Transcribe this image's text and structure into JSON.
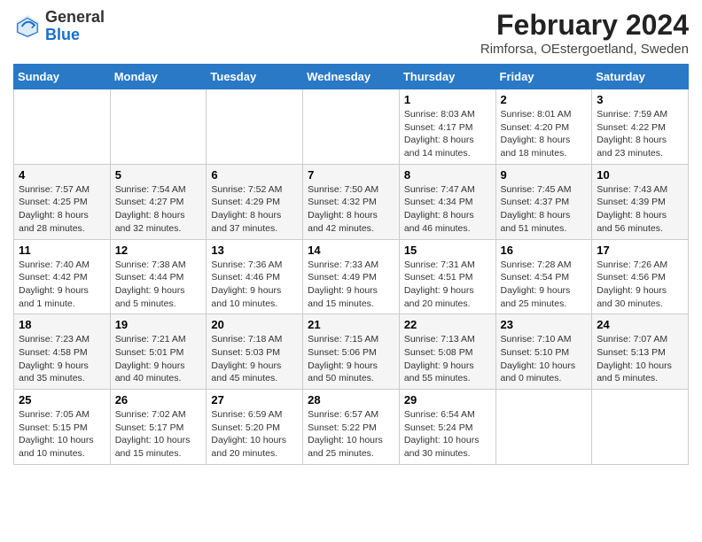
{
  "header": {
    "logo_general": "General",
    "logo_blue": "Blue",
    "title": "February 2024",
    "subtitle": "Rimforsa, OEstergoetland, Sweden"
  },
  "weekdays": [
    "Sunday",
    "Monday",
    "Tuesday",
    "Wednesday",
    "Thursday",
    "Friday",
    "Saturday"
  ],
  "weeks": [
    [
      {
        "day": "",
        "info": ""
      },
      {
        "day": "",
        "info": ""
      },
      {
        "day": "",
        "info": ""
      },
      {
        "day": "",
        "info": ""
      },
      {
        "day": "1",
        "info": "Sunrise: 8:03 AM\nSunset: 4:17 PM\nDaylight: 8 hours\nand 14 minutes."
      },
      {
        "day": "2",
        "info": "Sunrise: 8:01 AM\nSunset: 4:20 PM\nDaylight: 8 hours\nand 18 minutes."
      },
      {
        "day": "3",
        "info": "Sunrise: 7:59 AM\nSunset: 4:22 PM\nDaylight: 8 hours\nand 23 minutes."
      }
    ],
    [
      {
        "day": "4",
        "info": "Sunrise: 7:57 AM\nSunset: 4:25 PM\nDaylight: 8 hours\nand 28 minutes."
      },
      {
        "day": "5",
        "info": "Sunrise: 7:54 AM\nSunset: 4:27 PM\nDaylight: 8 hours\nand 32 minutes."
      },
      {
        "day": "6",
        "info": "Sunrise: 7:52 AM\nSunset: 4:29 PM\nDaylight: 8 hours\nand 37 minutes."
      },
      {
        "day": "7",
        "info": "Sunrise: 7:50 AM\nSunset: 4:32 PM\nDaylight: 8 hours\nand 42 minutes."
      },
      {
        "day": "8",
        "info": "Sunrise: 7:47 AM\nSunset: 4:34 PM\nDaylight: 8 hours\nand 46 minutes."
      },
      {
        "day": "9",
        "info": "Sunrise: 7:45 AM\nSunset: 4:37 PM\nDaylight: 8 hours\nand 51 minutes."
      },
      {
        "day": "10",
        "info": "Sunrise: 7:43 AM\nSunset: 4:39 PM\nDaylight: 8 hours\nand 56 minutes."
      }
    ],
    [
      {
        "day": "11",
        "info": "Sunrise: 7:40 AM\nSunset: 4:42 PM\nDaylight: 9 hours\nand 1 minute."
      },
      {
        "day": "12",
        "info": "Sunrise: 7:38 AM\nSunset: 4:44 PM\nDaylight: 9 hours\nand 5 minutes."
      },
      {
        "day": "13",
        "info": "Sunrise: 7:36 AM\nSunset: 4:46 PM\nDaylight: 9 hours\nand 10 minutes."
      },
      {
        "day": "14",
        "info": "Sunrise: 7:33 AM\nSunset: 4:49 PM\nDaylight: 9 hours\nand 15 minutes."
      },
      {
        "day": "15",
        "info": "Sunrise: 7:31 AM\nSunset: 4:51 PM\nDaylight: 9 hours\nand 20 minutes."
      },
      {
        "day": "16",
        "info": "Sunrise: 7:28 AM\nSunset: 4:54 PM\nDaylight: 9 hours\nand 25 minutes."
      },
      {
        "day": "17",
        "info": "Sunrise: 7:26 AM\nSunset: 4:56 PM\nDaylight: 9 hours\nand 30 minutes."
      }
    ],
    [
      {
        "day": "18",
        "info": "Sunrise: 7:23 AM\nSunset: 4:58 PM\nDaylight: 9 hours\nand 35 minutes."
      },
      {
        "day": "19",
        "info": "Sunrise: 7:21 AM\nSunset: 5:01 PM\nDaylight: 9 hours\nand 40 minutes."
      },
      {
        "day": "20",
        "info": "Sunrise: 7:18 AM\nSunset: 5:03 PM\nDaylight: 9 hours\nand 45 minutes."
      },
      {
        "day": "21",
        "info": "Sunrise: 7:15 AM\nSunset: 5:06 PM\nDaylight: 9 hours\nand 50 minutes."
      },
      {
        "day": "22",
        "info": "Sunrise: 7:13 AM\nSunset: 5:08 PM\nDaylight: 9 hours\nand 55 minutes."
      },
      {
        "day": "23",
        "info": "Sunrise: 7:10 AM\nSunset: 5:10 PM\nDaylight: 10 hours\nand 0 minutes."
      },
      {
        "day": "24",
        "info": "Sunrise: 7:07 AM\nSunset: 5:13 PM\nDaylight: 10 hours\nand 5 minutes."
      }
    ],
    [
      {
        "day": "25",
        "info": "Sunrise: 7:05 AM\nSunset: 5:15 PM\nDaylight: 10 hours\nand 10 minutes."
      },
      {
        "day": "26",
        "info": "Sunrise: 7:02 AM\nSunset: 5:17 PM\nDaylight: 10 hours\nand 15 minutes."
      },
      {
        "day": "27",
        "info": "Sunrise: 6:59 AM\nSunset: 5:20 PM\nDaylight: 10 hours\nand 20 minutes."
      },
      {
        "day": "28",
        "info": "Sunrise: 6:57 AM\nSunset: 5:22 PM\nDaylight: 10 hours\nand 25 minutes."
      },
      {
        "day": "29",
        "info": "Sunrise: 6:54 AM\nSunset: 5:24 PM\nDaylight: 10 hours\nand 30 minutes."
      },
      {
        "day": "",
        "info": ""
      },
      {
        "day": "",
        "info": ""
      }
    ]
  ]
}
